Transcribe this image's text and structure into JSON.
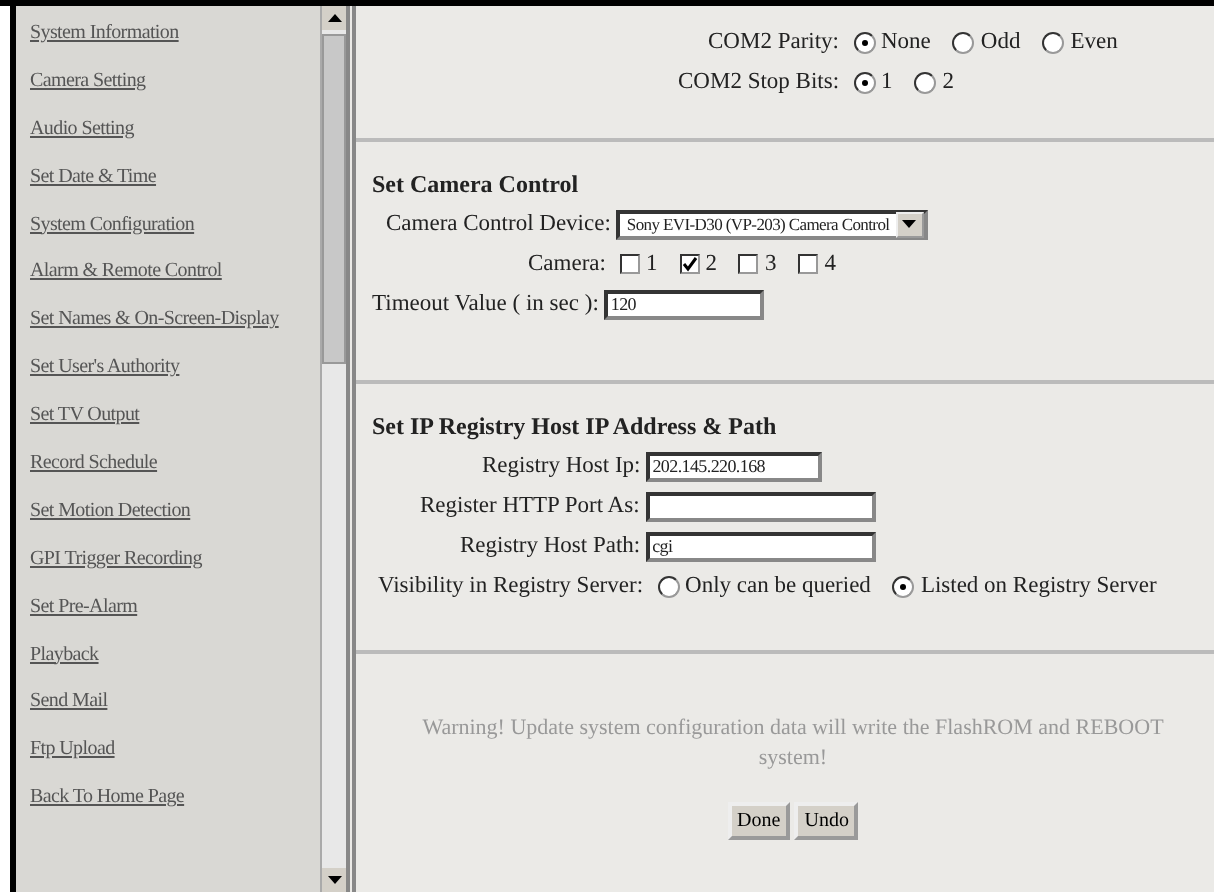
{
  "sidebar": {
    "links": [
      "System Information",
      "Camera Setting",
      "Audio Setting",
      "Set Date & Time",
      "System Configuration",
      "Alarm & Remote Control",
      "Set Names & On-Screen-Display",
      "Set User's Authority",
      "Set TV Output",
      "Record Schedule",
      "Set Motion Detection",
      "GPI Trigger Recording",
      "Set Pre-Alarm",
      "Playback",
      "Send Mail",
      "Ftp Upload",
      "Back To Home Page"
    ]
  },
  "serial": {
    "parity": {
      "label": "COM2 Parity:",
      "options": [
        {
          "label": "None",
          "selected": true
        },
        {
          "label": "Odd",
          "selected": false
        },
        {
          "label": "Even",
          "selected": false
        }
      ]
    },
    "stop_bits": {
      "label": "COM2 Stop Bits:",
      "options": [
        {
          "label": "1",
          "selected": true
        },
        {
          "label": "2",
          "selected": false
        }
      ]
    }
  },
  "camera_control": {
    "title": "Set Camera Control",
    "device": {
      "label": "Camera Control Device:",
      "value": "Sony EVI-D30 (VP-203) Camera Control"
    },
    "cameras": {
      "label": "Camera:",
      "options": [
        {
          "label": "1",
          "checked": false
        },
        {
          "label": "2",
          "checked": true
        },
        {
          "label": "3",
          "checked": false
        },
        {
          "label": "4",
          "checked": false
        }
      ]
    },
    "timeout": {
      "label": "Timeout Value ( in sec ):",
      "value": "120"
    }
  },
  "registry": {
    "title": "Set IP Registry Host IP Address & Path",
    "host_ip": {
      "label": "Registry Host Ip:",
      "value": "202.145.220.168"
    },
    "http_port": {
      "label": "Register HTTP Port As:"
    },
    "host_path": {
      "label": "Registry Host Path:",
      "value": "cgi"
    },
    "visibility": {
      "label": "Visibility in Registry Server:",
      "options": [
        {
          "label": "Only can be queried",
          "selected": false
        },
        {
          "label": "Listed on Registry Server",
          "selected": true
        }
      ]
    }
  },
  "warning": "Warning! Update system configuration data will write the FlashROM and REBOOT system!",
  "buttons": [
    "Done",
    "Undo"
  ]
}
